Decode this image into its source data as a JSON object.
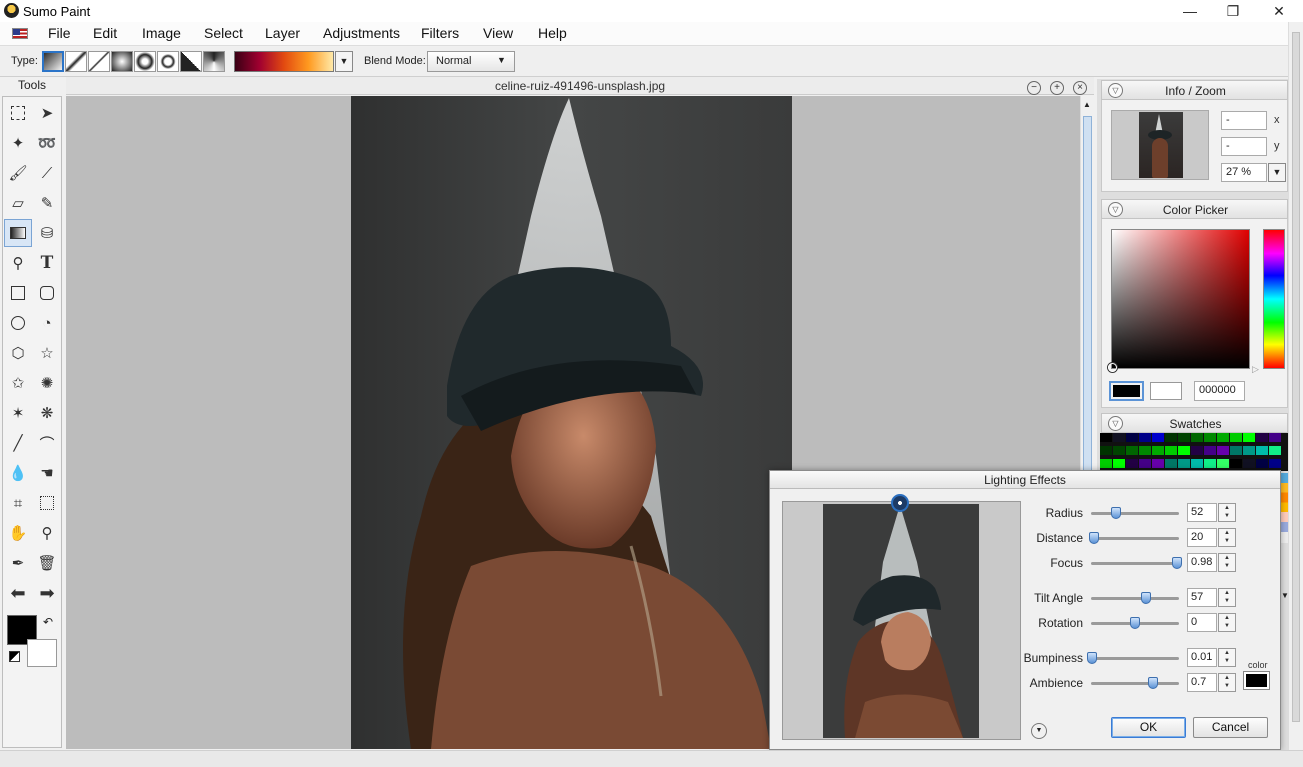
{
  "window": {
    "title": "Sumo Paint",
    "minimize_glyph": "—",
    "maximize_glyph": "❐",
    "close_glyph": "✕"
  },
  "menu": [
    "File",
    "Edit",
    "Image",
    "Select",
    "Layer",
    "Adjustments",
    "Filters",
    "View",
    "Help"
  ],
  "options": {
    "type_label": "Type:",
    "blend_label": "Blend Mode:",
    "blend_value": "Normal",
    "dropdown_glyph": "▼"
  },
  "tools": {
    "label": "Tools",
    "type_glyph": "T"
  },
  "document": {
    "filename": "celine-ruiz-491496-unsplash.jpg",
    "zoom_out_glyph": "−",
    "zoom_in_glyph": "+",
    "close_glyph": "×"
  },
  "info_zoom": {
    "title": "Info / Zoom",
    "x_value": "-",
    "y_value": "-",
    "x_label": "x",
    "y_label": "y",
    "zoom_value": "27 %"
  },
  "color_picker": {
    "title": "Color Picker",
    "hex_value": "000000",
    "primary_color": "#000000",
    "secondary_color": "#ffffff"
  },
  "swatches": {
    "title": "Swatches"
  },
  "panel_toggle_glyph": "▽",
  "lighting": {
    "title": "Lighting Effects",
    "params": [
      {
        "label": "Radius",
        "value": "52",
        "fraction": 0.28
      },
      {
        "label": "Distance",
        "value": "20",
        "fraction": 0.03
      },
      {
        "label": "Focus",
        "value": "0.98",
        "fraction": 0.98
      },
      {
        "label": "Tilt Angle",
        "value": "57",
        "fraction": 0.63
      },
      {
        "label": "Rotation",
        "value": "0",
        "fraction": 0.5
      },
      {
        "label": "Bumpiness",
        "value": "0.01",
        "fraction": 0.01
      },
      {
        "label": "Ambience",
        "value": "0.7",
        "fraction": 0.7
      }
    ],
    "color_label": "color",
    "light_color": "#000000",
    "ok_label": "OK",
    "cancel_label": "Cancel",
    "expand_glyph": "▼"
  },
  "colors": {
    "accent": "#2b74c8"
  }
}
